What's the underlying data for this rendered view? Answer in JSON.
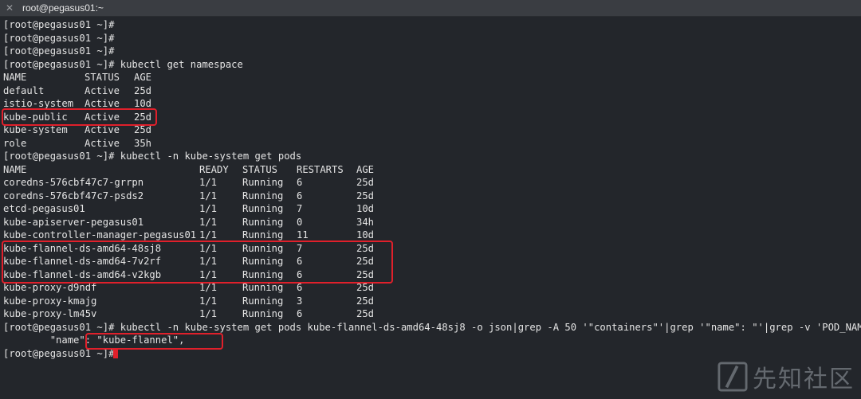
{
  "window": {
    "title": "root@pegasus01:~"
  },
  "prompt": "[root@pegasus01 ~]#",
  "lines": {
    "l0": "[root@pegasus01 ~]#",
    "l1": "[root@pegasus01 ~]#",
    "l2": "[root@pegasus01 ~]#",
    "l3": "[root@pegasus01 ~]# kubectl get namespace",
    "l10": "[root@pegasus01 ~]# kubectl -n kube-system get pods",
    "l25": "[root@pegasus01 ~]# kubectl -n kube-system get pods kube-flannel-ds-amd64-48sj8 -o json|grep -A 50 '\"containers\"'|grep '\"name\": \"'|grep -v 'POD_NAME'",
    "l26": "        \"name\": \"kube-flannel\",",
    "l27": "[root@pegasus01 ~]#"
  },
  "namespaces": {
    "headers": [
      "NAME",
      "STATUS",
      "AGE"
    ],
    "rows": [
      [
        "default",
        "Active",
        "25d"
      ],
      [
        "istio-system",
        "Active",
        "10d"
      ],
      [
        "kube-public",
        "Active",
        "25d"
      ],
      [
        "kube-system",
        "Active",
        "25d"
      ],
      [
        "role",
        "Active",
        "35h"
      ]
    ]
  },
  "pods": {
    "headers": [
      "NAME",
      "READY",
      "STATUS",
      "RESTARTS",
      "AGE"
    ],
    "rows": [
      [
        "coredns-576cbf47c7-grrpn",
        "1/1",
        "Running",
        "6",
        "25d"
      ],
      [
        "coredns-576cbf47c7-psds2",
        "1/1",
        "Running",
        "6",
        "25d"
      ],
      [
        "etcd-pegasus01",
        "1/1",
        "Running",
        "7",
        "10d"
      ],
      [
        "kube-apiserver-pegasus01",
        "1/1",
        "Running",
        "0",
        "34h"
      ],
      [
        "kube-controller-manager-pegasus01",
        "1/1",
        "Running",
        "11",
        "10d"
      ],
      [
        "kube-flannel-ds-amd64-48sj8",
        "1/1",
        "Running",
        "7",
        "25d"
      ],
      [
        "kube-flannel-ds-amd64-7v2rf",
        "1/1",
        "Running",
        "6",
        "25d"
      ],
      [
        "kube-flannel-ds-amd64-v2kgb",
        "1/1",
        "Running",
        "6",
        "25d"
      ],
      [
        "kube-proxy-d9ndf",
        "1/1",
        "Running",
        "6",
        "25d"
      ],
      [
        "kube-proxy-kmajg",
        "1/1",
        "Running",
        "3",
        "25d"
      ],
      [
        "kube-proxy-lm45v",
        "1/1",
        "Running",
        "6",
        "25d"
      ]
    ]
  },
  "watermark": {
    "text": "先知社区"
  },
  "colors": {
    "background": "#23262b",
    "text": "#e4e4e4",
    "highlight": "#e0202b"
  }
}
